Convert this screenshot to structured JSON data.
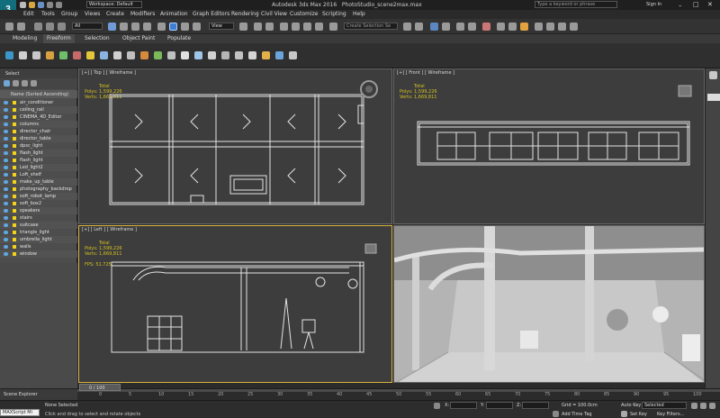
{
  "app": {
    "title": "Autodesk 3ds Max 2016",
    "file": "PhotoStudio_scene2max.max",
    "workspace": "Workspace: Default",
    "search_placeholder": "Type a keyword or phrase",
    "sign_in": "Sign In",
    "logo": "3"
  },
  "menu": [
    "Edit",
    "Tools",
    "Group",
    "Views",
    "Create",
    "Modifiers",
    "Animation",
    "Graph Editors",
    "Rendering",
    "Civil View",
    "Customize",
    "Scripting",
    "Help"
  ],
  "toolbar": {
    "filter_value": "All",
    "view_value": "View",
    "selection_set_placeholder": "Create Selection Se"
  },
  "ribbon_tabs": [
    "Modeling",
    "Freeform",
    "Selection",
    "Object Paint",
    "Populate"
  ],
  "scene_explorer": {
    "select_label": "Select",
    "header": "Name (Sorted Ascending)",
    "items": [
      "air_conditioner",
      "ceiling_rail",
      "CINEMA_4D_Editor",
      "columns",
      "director_chair",
      "director_table",
      "dpsc_light",
      "flash_light",
      "flash_light",
      "Led_light2",
      "Loft_shelf",
      "make_up_table",
      "photography_backdrop",
      "soft_robot_lamp",
      "soft_box2",
      "speakers",
      "stairs",
      "suitcase",
      "triangle_light",
      "umbrella_light",
      "walls",
      "window"
    ],
    "footer": "Scene Explorer"
  },
  "viewports": {
    "top": {
      "label": "[+] [ Top ] [ Wireframe ]",
      "stats_title": "Total",
      "polys_label": "Polys:",
      "polys_value": "1,599,226",
      "verts_label": "Verts:",
      "verts_value": "1,669,811"
    },
    "front": {
      "label": "[+] [ Front ] [ Wireframe ]",
      "stats_title": "Total",
      "polys_label": "Polys:",
      "polys_value": "1,599,226",
      "verts_label": "Verts:",
      "verts_value": "1,669,811"
    },
    "left": {
      "label": "[+] [ Left ] [ Wireframe ]",
      "stats_title": "Total",
      "polys_label": "Polys:",
      "polys_value": "1,599,226",
      "verts_label": "Verts:",
      "verts_value": "1,669,811",
      "fps_label": "FPS:",
      "fps_value": "51.725"
    }
  },
  "timeline": {
    "slider": "0 / 100",
    "ticks": [
      "0",
      "5",
      "10",
      "15",
      "20",
      "25",
      "30",
      "35",
      "40",
      "45",
      "50",
      "55",
      "60",
      "65",
      "70",
      "75",
      "80",
      "85",
      "90",
      "95",
      "100"
    ]
  },
  "status": {
    "maxscript": "MAXScript Mi",
    "selection": "None Selected",
    "prompt": "Click and drag to select and rotate objects",
    "x_label": "X:",
    "y_label": "Y:",
    "z_label": "Z:",
    "grid": "Grid = 100.0cm",
    "add_time_tag": "Add Time Tag",
    "auto_key": "Auto Key",
    "selected_value": "Selected",
    "set_key": "Set Key",
    "key_filters": "Key Filters..."
  },
  "colors": {
    "accent_teal": "#126e7d",
    "active_border": "#d7b341",
    "stats_yellow": "#d6c11f",
    "viewport_bg": "#3d3d3d"
  }
}
